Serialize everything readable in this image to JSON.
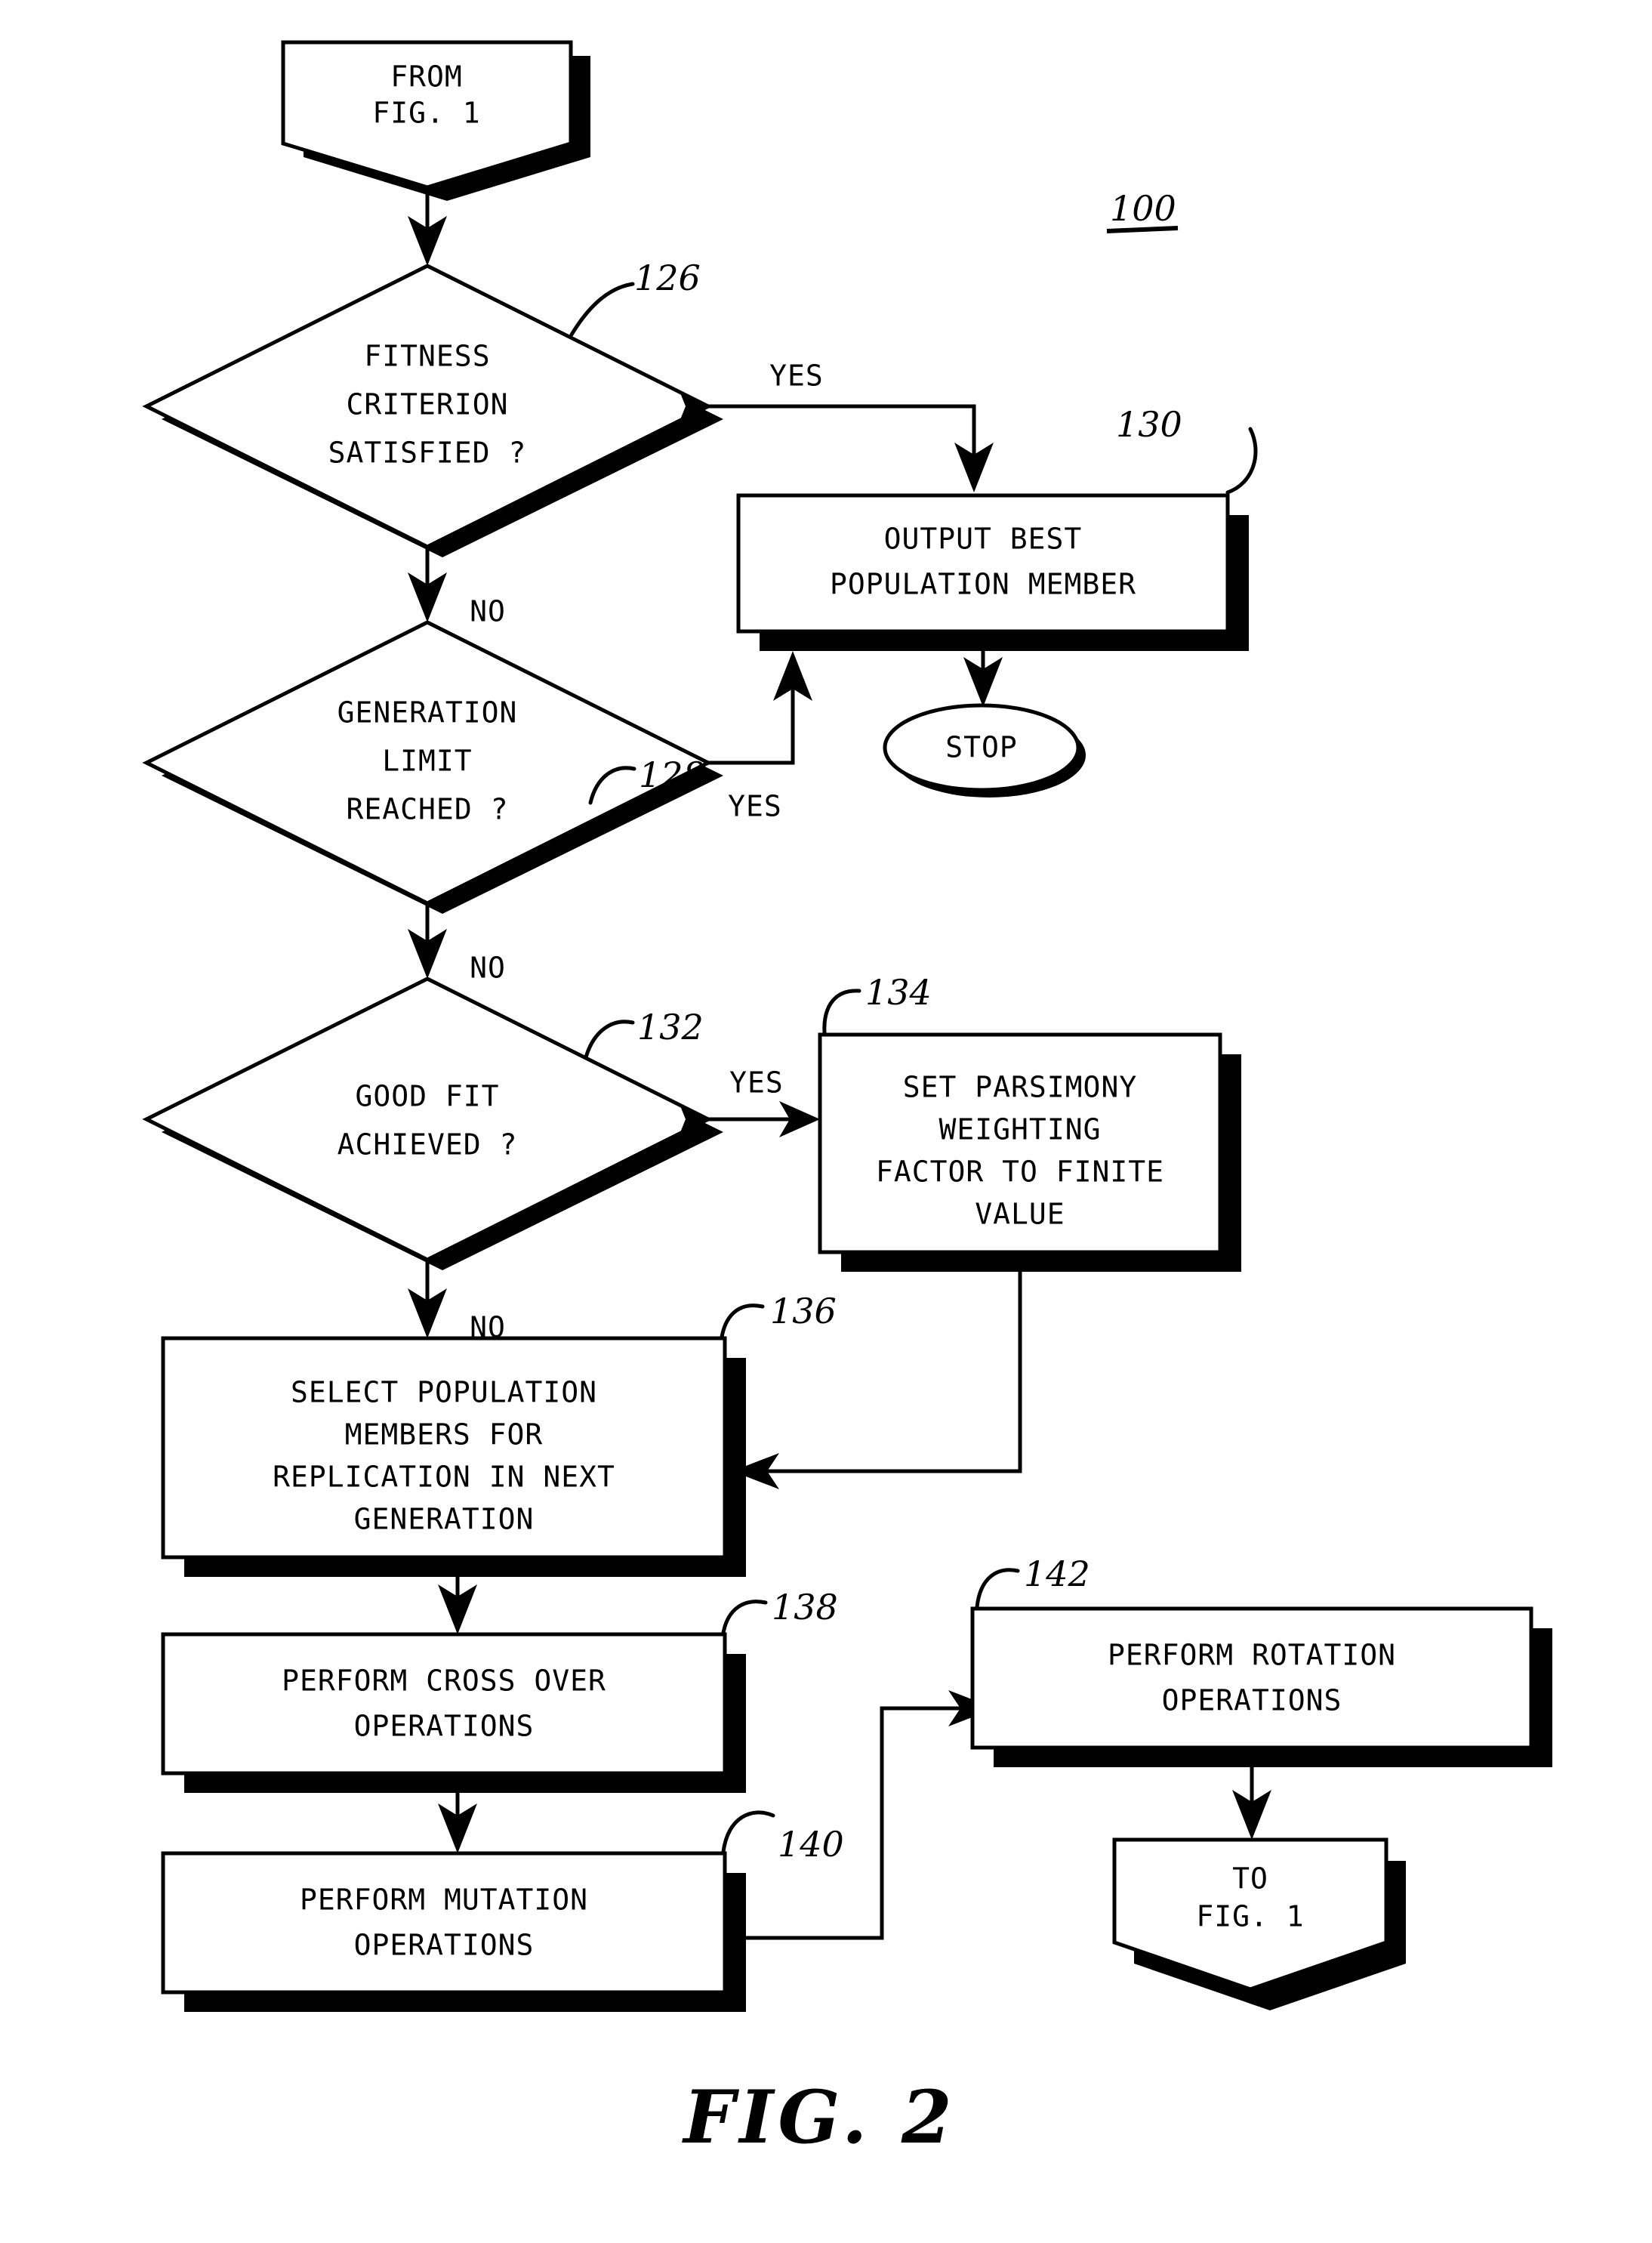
{
  "figure": {
    "caption": "FIG. 2",
    "system_ref": "100"
  },
  "nodes": [
    {
      "id": "from-fig-1",
      "kind": "terminator-pentagon",
      "lines": [
        "FROM",
        "FIG. 1"
      ],
      "ref": ""
    },
    {
      "id": "fitness-criterion",
      "kind": "decision",
      "lines": [
        "FITNESS",
        "CRITERION",
        "SATISFIED ?"
      ],
      "ref": "126"
    },
    {
      "id": "output-best-population-member",
      "kind": "process",
      "lines": [
        "OUTPUT BEST",
        "POPULATION MEMBER"
      ],
      "ref": "130"
    },
    {
      "id": "stop",
      "kind": "terminator-ellipse",
      "lines": [
        "STOP"
      ],
      "ref": ""
    },
    {
      "id": "generation-limit",
      "kind": "decision",
      "lines": [
        "GENERATION",
        "LIMIT",
        "REACHED ?"
      ],
      "ref": "128"
    },
    {
      "id": "good-fit",
      "kind": "decision",
      "lines": [
        "GOOD FIT",
        "ACHIEVED ?"
      ],
      "ref": "132"
    },
    {
      "id": "set-parsimony",
      "kind": "process",
      "lines": [
        "SET PARSIMONY",
        "WEIGHTING",
        "FACTOR TO FINITE",
        "VALUE"
      ],
      "ref": "134"
    },
    {
      "id": "select-population",
      "kind": "process",
      "lines": [
        "SELECT POPULATION",
        "MEMBERS FOR",
        "REPLICATION IN NEXT",
        "GENERATION"
      ],
      "ref": "136"
    },
    {
      "id": "perform-cross-over",
      "kind": "process",
      "lines": [
        "PERFORM CROSS OVER",
        "OPERATIONS"
      ],
      "ref": "138"
    },
    {
      "id": "perform-mutation",
      "kind": "process",
      "lines": [
        "PERFORM MUTATION",
        "OPERATIONS"
      ],
      "ref": "140"
    },
    {
      "id": "perform-rotation",
      "kind": "process",
      "lines": [
        "PERFORM ROTATION",
        "OPERATIONS"
      ],
      "ref": "142"
    },
    {
      "id": "to-fig-1",
      "kind": "terminator-pentagon",
      "lines": [
        "TO",
        "FIG. 1"
      ],
      "ref": ""
    }
  ],
  "edge_labels": {
    "fitness_yes": "YES",
    "fitness_no": "NO",
    "generation_yes": "YES",
    "generation_no": "NO",
    "goodfit_yes": "YES",
    "goodfit_no": "NO"
  },
  "text": {
    "from_fig_line1": "FROM",
    "from_fig_line2": "FIG. 1",
    "fitness_l1": "FITNESS",
    "fitness_l2": "CRITERION",
    "fitness_l3": "SATISFIED ?",
    "output_l1": "OUTPUT BEST",
    "output_l2": "POPULATION MEMBER",
    "stop": "STOP",
    "generation_l1": "GENERATION",
    "generation_l2": "LIMIT",
    "generation_l3": "REACHED ?",
    "goodfit_l1": "GOOD FIT",
    "goodfit_l2": "ACHIEVED ?",
    "parsimony_l1": "SET PARSIMONY",
    "parsimony_l2": "WEIGHTING",
    "parsimony_l3": "FACTOR TO FINITE",
    "parsimony_l4": "VALUE",
    "select_l1": "SELECT POPULATION",
    "select_l2": "MEMBERS FOR",
    "select_l3": "REPLICATION IN NEXT",
    "select_l4": "GENERATION",
    "crossover_l1": "PERFORM CROSS OVER",
    "crossover_l2": "OPERATIONS",
    "mutation_l1": "PERFORM MUTATION",
    "mutation_l2": "OPERATIONS",
    "rotation_l1": "PERFORM ROTATION",
    "rotation_l2": "OPERATIONS",
    "tofig_l1": "TO",
    "tofig_l2": "FIG. 1"
  },
  "refs": {
    "r100": "100",
    "r126": "126",
    "r128": "128",
    "r130": "130",
    "r132": "132",
    "r134": "134",
    "r136": "136",
    "r138": "138",
    "r140": "140",
    "r142": "142"
  },
  "colors": {
    "ink": "#000000",
    "paper": "#ffffff"
  }
}
